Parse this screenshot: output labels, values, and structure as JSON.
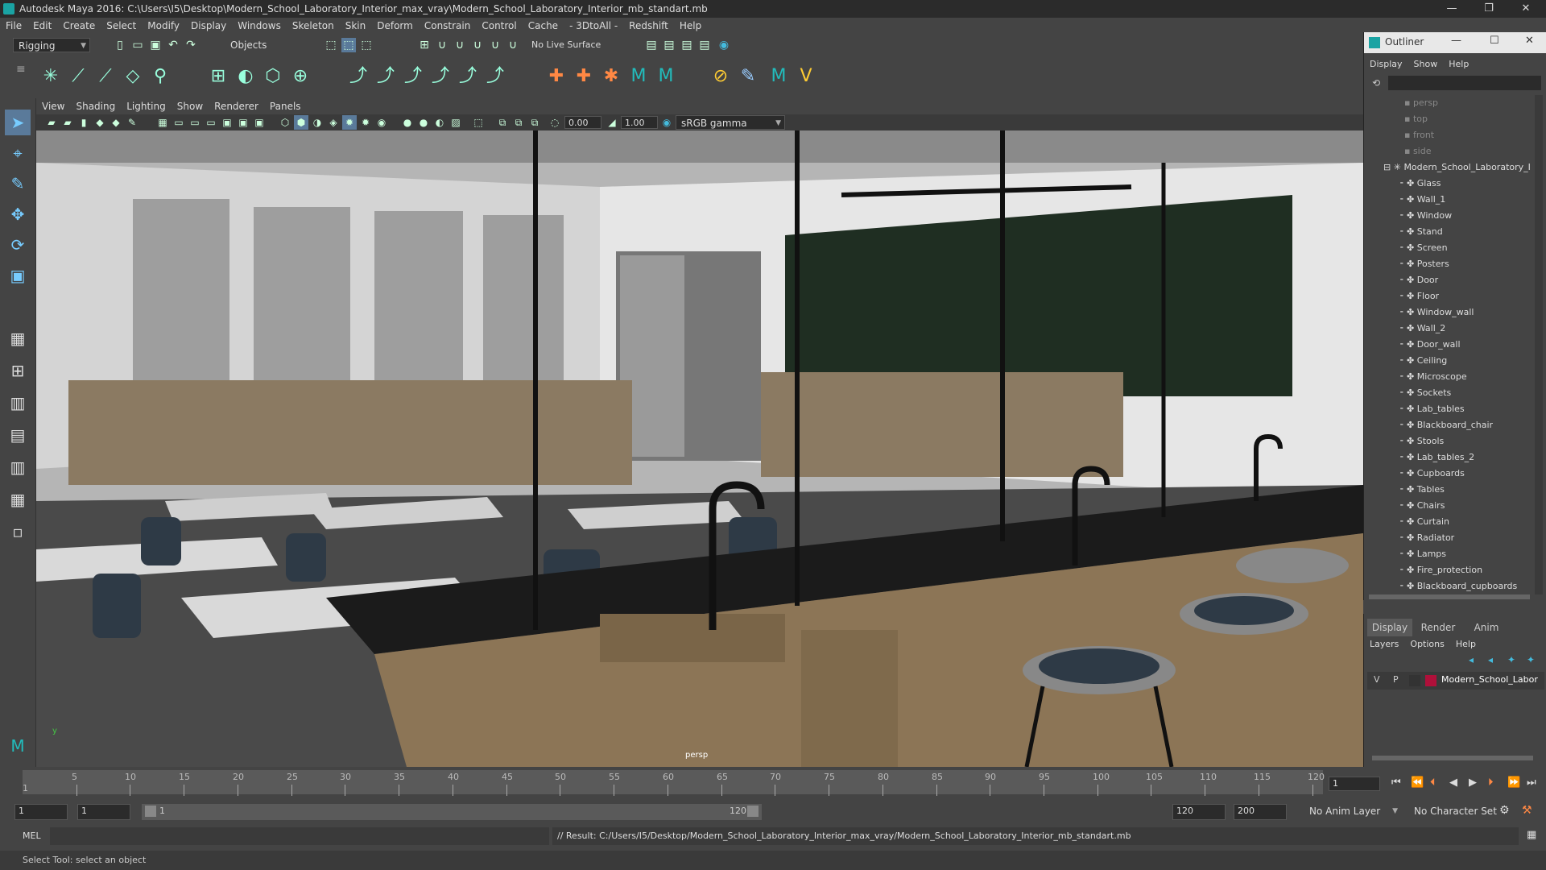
{
  "window": {
    "title": "Autodesk Maya 2016: C:\\Users\\I5\\Desktop\\Modern_School_Laboratory_Interior_max_vray\\Modern_School_Laboratory_Interior_mb_standart.mb",
    "minimize": "—",
    "maximize": "❐",
    "close": "✕"
  },
  "menubar": [
    "File",
    "Edit",
    "Create",
    "Select",
    "Modify",
    "Display",
    "Windows",
    "Skeleton",
    "Skin",
    "Deform",
    "Constrain",
    "Control",
    "Cache",
    "- 3DtoAll -",
    "Redshift",
    "Help"
  ],
  "statusline": {
    "menuset": "Rigging",
    "selection_mode": "Objects",
    "live_surface": "No Live Surface"
  },
  "viewport": {
    "menu": [
      "View",
      "Shading",
      "Lighting",
      "Show",
      "Renderer",
      "Panels"
    ],
    "exposure": "0.00",
    "gamma": "1.00",
    "color_space": "sRGB gamma",
    "camera_label": "persp"
  },
  "outliner": {
    "title": "Outliner",
    "menu": [
      "Display",
      "Show",
      "Help"
    ],
    "cameras": [
      "persp",
      "top",
      "front",
      "side"
    ],
    "root": "Modern_School_Laboratory_I",
    "children": [
      "Glass",
      "Wall_1",
      "Window",
      "Stand",
      "Screen",
      "Posters",
      "Door",
      "Floor",
      "Window_wall",
      "Wall_2",
      "Door_wall",
      "Ceiling",
      "Microscope",
      "Sockets",
      "Lab_tables",
      "Blackboard_chair",
      "Stools",
      "Lab_tables_2",
      "Cupboards",
      "Tables",
      "Chairs",
      "Curtain",
      "Radiator",
      "Lamps",
      "Fire_protection",
      "Blackboard_cupboards"
    ]
  },
  "layer_editor": {
    "tabs": [
      "Display",
      "Render",
      "Anim"
    ],
    "menu": [
      "Layers",
      "Options",
      "Help"
    ],
    "layer": {
      "v": "V",
      "p": "P",
      "name": "Modern_School_Labor",
      "color": "#b0103a"
    }
  },
  "timeslider": {
    "ticks": [
      5,
      10,
      15,
      20,
      25,
      30,
      35,
      40,
      45,
      50,
      55,
      60,
      65,
      70,
      75,
      80,
      85,
      90,
      95,
      100,
      105,
      110,
      115,
      120
    ],
    "first_label": "1",
    "current_frame": "1"
  },
  "rangeslider": {
    "start": "1",
    "playback_start": "1",
    "range_start_label": "1",
    "range_end_label": "120",
    "playback_end": "120",
    "end": "200",
    "anim_layer": "No Anim Layer",
    "character_set": "No Character Set"
  },
  "cmdline": {
    "lang": "MEL",
    "result": "// Result: C:/Users/I5/Desktop/Modern_School_Laboratory_Interior_max_vray/Modern_School_Laboratory_Interior_mb_standart.mb"
  },
  "helpline": "Select Tool: select an object"
}
